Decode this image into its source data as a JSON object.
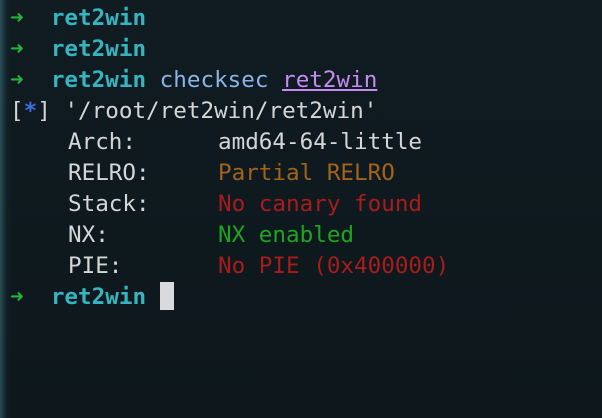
{
  "prompt": {
    "arrow": "➜",
    "cwd": "ret2win"
  },
  "history": [
    {
      "cwd": "ret2win"
    },
    {
      "cwd": "ret2win"
    },
    {
      "cwd": "ret2win",
      "command": "checksec",
      "argument": "ret2win"
    }
  ],
  "output": {
    "marker_open": "[",
    "marker_star": "*",
    "marker_close": "]",
    "file_path": "'/root/ret2win/ret2win'",
    "rows": [
      {
        "key": "Arch:",
        "value": "amd64-64-little",
        "color": "#d4d7d6"
      },
      {
        "key": "RELRO:",
        "value": "Partial RELRO",
        "color": "#a4631a"
      },
      {
        "key": "Stack:",
        "value": "No canary found",
        "color": "#a81c1c"
      },
      {
        "key": "NX:",
        "value": "NX enabled",
        "color": "#1fa51f"
      },
      {
        "key": "PIE:",
        "value": "No PIE (0x400000)",
        "color": "#a81c1c"
      }
    ]
  },
  "current_prompt": {
    "cwd": "ret2win"
  }
}
